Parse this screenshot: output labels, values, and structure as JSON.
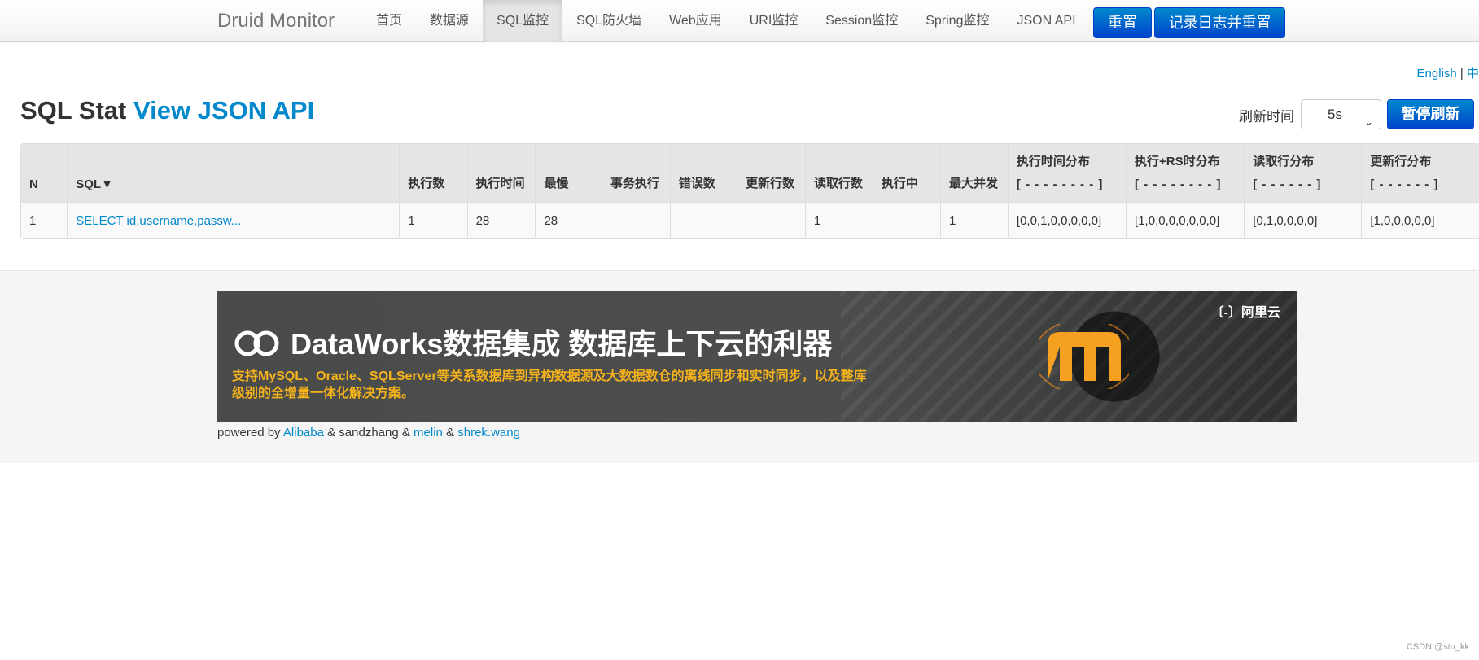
{
  "navbar": {
    "brand": "Druid Monitor",
    "items": [
      "首页",
      "数据源",
      "SQL监控",
      "SQL防火墙",
      "Web应用",
      "URI监控",
      "Session监控",
      "Spring监控",
      "JSON API"
    ],
    "active_index": 2,
    "reset_label": "重置",
    "log_reset_label": "记录日志并重置"
  },
  "language": {
    "english": "English",
    "separator": " | ",
    "chinese": "中"
  },
  "header": {
    "title": "SQL Stat",
    "json_link": "View JSON API",
    "refresh_label": "刷新时间",
    "refresh_value": "5s",
    "pause_label": "暂停刷新"
  },
  "table": {
    "headers": {
      "n": "N",
      "sql": "SQL▼",
      "exec_count": "执行数",
      "exec_time": "执行时间",
      "slowest": "最慢",
      "tx_exec": "事务执行",
      "errors": "错误数",
      "update_rows": "更新行数",
      "read_rows": "读取行数",
      "running": "执行中",
      "max_concurrent": "最大并发",
      "exec_time_dist": "执行时间分布",
      "exec_time_dist_sub": "[ - - - - - - - - ]",
      "exec_rs_dist": "执行+RS时分布",
      "exec_rs_dist_sub": "[ - - - - - - - - ]",
      "read_dist": "读取行分布",
      "read_dist_sub": "[ - - - - - - ]",
      "update_dist": "更新行分布",
      "update_dist_sub": "[ - - - - - - ]"
    },
    "rows": [
      {
        "n": "1",
        "sql": "SELECT id,username,passw...",
        "exec_count": "1",
        "exec_time": "28",
        "slowest": "28",
        "tx_exec": "",
        "errors": "",
        "update_rows": "",
        "read_rows": "1",
        "running": "",
        "max_concurrent": "1",
        "exec_time_dist": "[0,0,1,0,0,0,0,0]",
        "exec_rs_dist": "[1,0,0,0,0,0,0,0]",
        "read_dist": "[0,1,0,0,0,0]",
        "update_dist": "[1,0,0,0,0,0]"
      }
    ]
  },
  "banner": {
    "headline": "DataWorks数据集成 数据库上下云的利器",
    "sub": "支持MySQL、Oracle、SQLServer等关系数据库到异构数据源及大数据数仓的离线同步和实时同步，以及整库级别的全增量一体化解决方案。",
    "brand": "〔-〕阿里云"
  },
  "footer": {
    "powered_by": "powered by",
    "alibaba": "Alibaba",
    "amp1": " & sandzhang & ",
    "melin": "melin",
    "amp2": " & ",
    "shrek": "shrek.wang"
  },
  "watermark": "CSDN @stu_kk",
  "colors": {
    "primary": "#0088cc",
    "primary_dark": "#0044cc",
    "banner_accent": "#f5b21b"
  }
}
